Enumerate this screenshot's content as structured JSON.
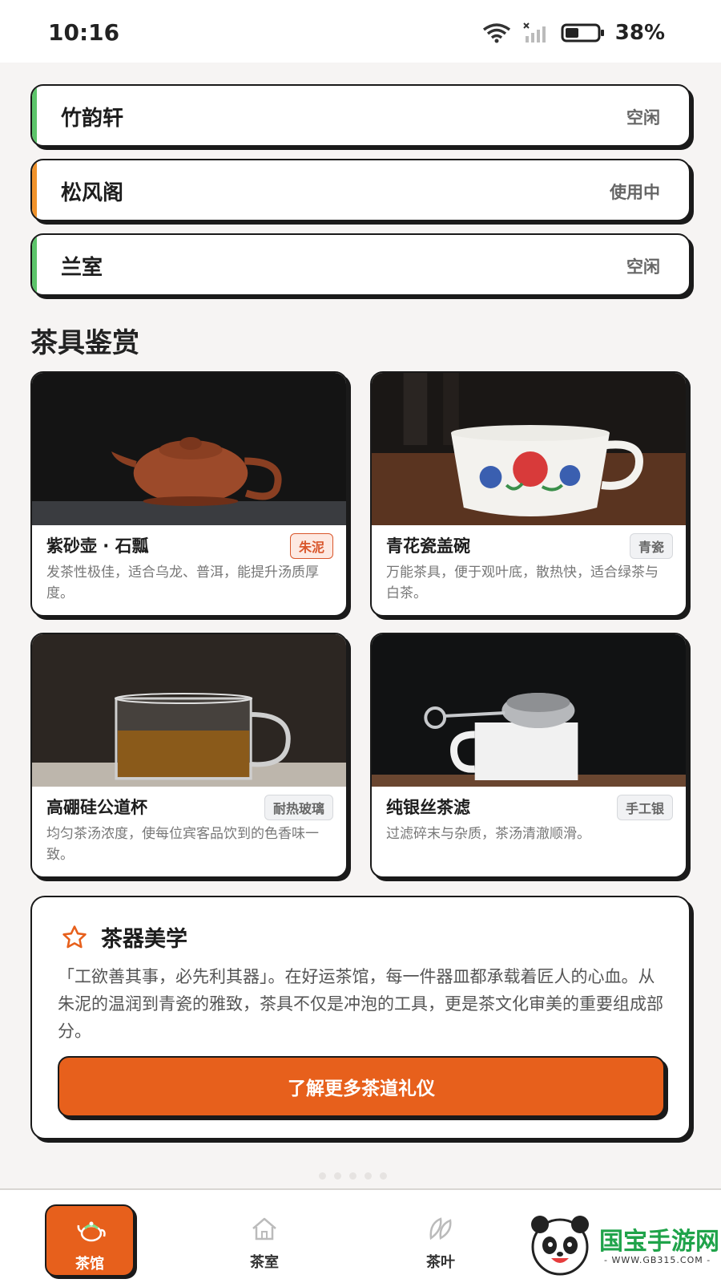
{
  "status_bar": {
    "time": "10:16",
    "battery": "38%"
  },
  "rooms": [
    {
      "name": "竹韵轩",
      "status": "空闲",
      "accent": "#5cc46a"
    },
    {
      "name": "松风阁",
      "status": "使用中",
      "accent": "#f0922b"
    },
    {
      "name": "兰室",
      "status": "空闲",
      "accent": "#5cc46a"
    }
  ],
  "section": {
    "title": "茶具鉴赏"
  },
  "cards": [
    {
      "title": "紫砂壶 · 石瓢",
      "tag": "朱泥",
      "desc": "发茶性极佳，适合乌龙、普洱，能提升汤质厚度。"
    },
    {
      "title": "青花瓷盖碗",
      "tag": "青瓷",
      "desc": "万能茶具，便于观叶底，散热快，适合绿茶与白茶。"
    },
    {
      "title": "高硼硅公道杯",
      "tag": "耐热玻璃",
      "desc": "均匀茶汤浓度，使每位宾客品饮到的色香味一致。"
    },
    {
      "title": "纯银丝茶滤",
      "tag": "手工银",
      "desc": "过滤碎末与杂质，茶汤清澈顺滑。"
    }
  ],
  "aesthetics": {
    "title": "茶器美学",
    "body": "「工欲善其事，必先利其器」。在好运茶馆，每一件器皿都承载着匠人的心血。从朱泥的温润到青瓷的雅致，茶具不仅是冲泡的工具，更是茶文化审美的重要组成部分。",
    "button": "了解更多茶道礼仪"
  },
  "nav": [
    {
      "label": "茶馆",
      "active": true
    },
    {
      "label": "茶室",
      "active": false
    },
    {
      "label": "茶叶",
      "active": false
    }
  ],
  "watermark": {
    "name": "国宝手游网",
    "url": "WWW.GB315.COM"
  },
  "colors": {
    "accent": "#e7601c",
    "idle": "#5cc46a",
    "busy": "#f0922b"
  }
}
